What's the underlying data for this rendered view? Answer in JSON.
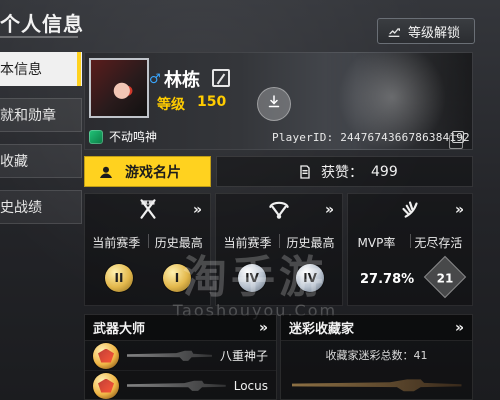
{
  "page": {
    "title": "个人信息",
    "unlock_button_label": "等级解锁"
  },
  "sidebar": {
    "items": [
      {
        "label": "本信息",
        "active": true
      },
      {
        "label": "就和勋章",
        "active": false
      },
      {
        "label": "收藏",
        "active": false
      },
      {
        "label": "史战绩",
        "active": false
      }
    ]
  },
  "profile": {
    "name": "林栋",
    "level_label": "等级",
    "level_value": "150",
    "title": "不动鸣神",
    "player_id": "PlayerID: 2447674366786384192"
  },
  "actions": {
    "game_card_label": "游戏名片",
    "likes_label": "获赞：",
    "likes_value": "499"
  },
  "stats": {
    "panel1": {
      "chevron": "»",
      "label_current": "当前赛季",
      "label_history": "历史最高",
      "badge_left_text": "II",
      "badge_right_text": "I"
    },
    "panel2": {
      "chevron": "»",
      "label_current": "当前赛季",
      "label_history": "历史最高",
      "badge_left_text": "IV",
      "badge_right_text": "IV"
    },
    "panel3": {
      "chevron": "»",
      "label_mvp": "MVP率",
      "label_endless": "无尽存活",
      "mvp_value": "27.78%",
      "endless_value": "21"
    }
  },
  "watermark": {
    "main": "淘手游",
    "sub": "Taoshouyou.Com"
  },
  "bottom": {
    "weapon_master": {
      "title": "武器大师",
      "chevron": "»",
      "rows": [
        {
          "name": "八重神子"
        },
        {
          "name": "Locus"
        }
      ]
    },
    "collector": {
      "title": "迷彩收藏家",
      "chevron": "»",
      "total_label": "收藏家迷彩总数：",
      "total_value": "41"
    }
  },
  "colors": {
    "accent_yellow": "#ffd21f",
    "level_yellow": "#ffcc00",
    "gender_blue": "#3aa7ff"
  }
}
